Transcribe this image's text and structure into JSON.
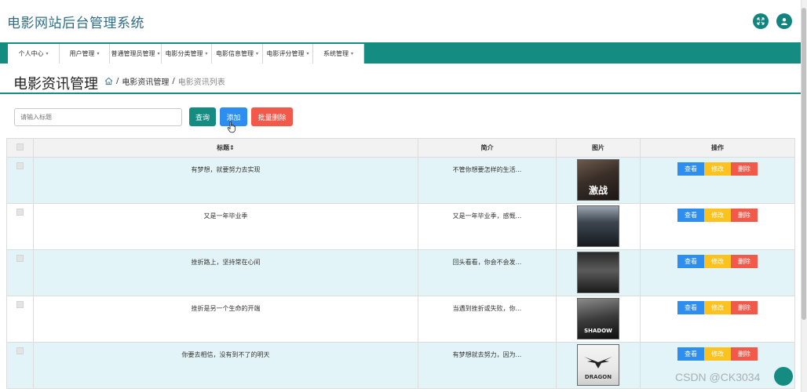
{
  "app": {
    "title": "电影网站后台管理系统"
  },
  "header_icons": [
    "expand-icon",
    "user-icon"
  ],
  "nav": {
    "items": [
      {
        "label": "个人中心"
      },
      {
        "label": "用户管理"
      },
      {
        "label": "普通管理员管理"
      },
      {
        "label": "电影分类管理"
      },
      {
        "label": "电影信息管理"
      },
      {
        "label": "电影评分管理"
      },
      {
        "label": "系统管理"
      }
    ]
  },
  "page": {
    "title": "电影资讯管理",
    "breadcrumb": {
      "sep": "/",
      "parent": "电影资讯管理",
      "current": "电影资讯列表"
    }
  },
  "toolbar": {
    "search_placeholder": "请输入标题",
    "query_label": "查询",
    "add_label": "添加",
    "batch_delete_label": "批量删除"
  },
  "table": {
    "columns": {
      "title": "标题",
      "summary": "简介",
      "image": "图片",
      "actions": "操作"
    },
    "sort_icon": "sort-icon",
    "rows": [
      {
        "title": "有梦想，就要努力去实现",
        "summary": "不管你想要怎样的生活...",
        "poster_text": "激战"
      },
      {
        "title": "又是一年毕业季",
        "summary": "又是一年毕业季，感慨...",
        "poster_text": ""
      },
      {
        "title": "挫折路上，坚持常在心间",
        "summary": "回头看看，你会不会发...",
        "poster_text": ""
      },
      {
        "title": "挫折是另一个生命的开端",
        "summary": "当遇到挫折或失败，你...",
        "poster_text": "SHADOW"
      },
      {
        "title": "你要去相信，没有到不了的明天",
        "summary": "有梦想就去努力，因为...",
        "poster_text": "DRAGON"
      }
    ],
    "actions": {
      "view": "查看",
      "edit": "修改",
      "delete": "删除"
    }
  },
  "watermark": "CSDN @CK3034",
  "colors": {
    "primary": "#148c82",
    "title_text": "#2f6e88",
    "view": "#2d8ef0",
    "edit": "#fbc220",
    "delete": "#f15a4a",
    "row_highlight": "#e3f4f8"
  }
}
